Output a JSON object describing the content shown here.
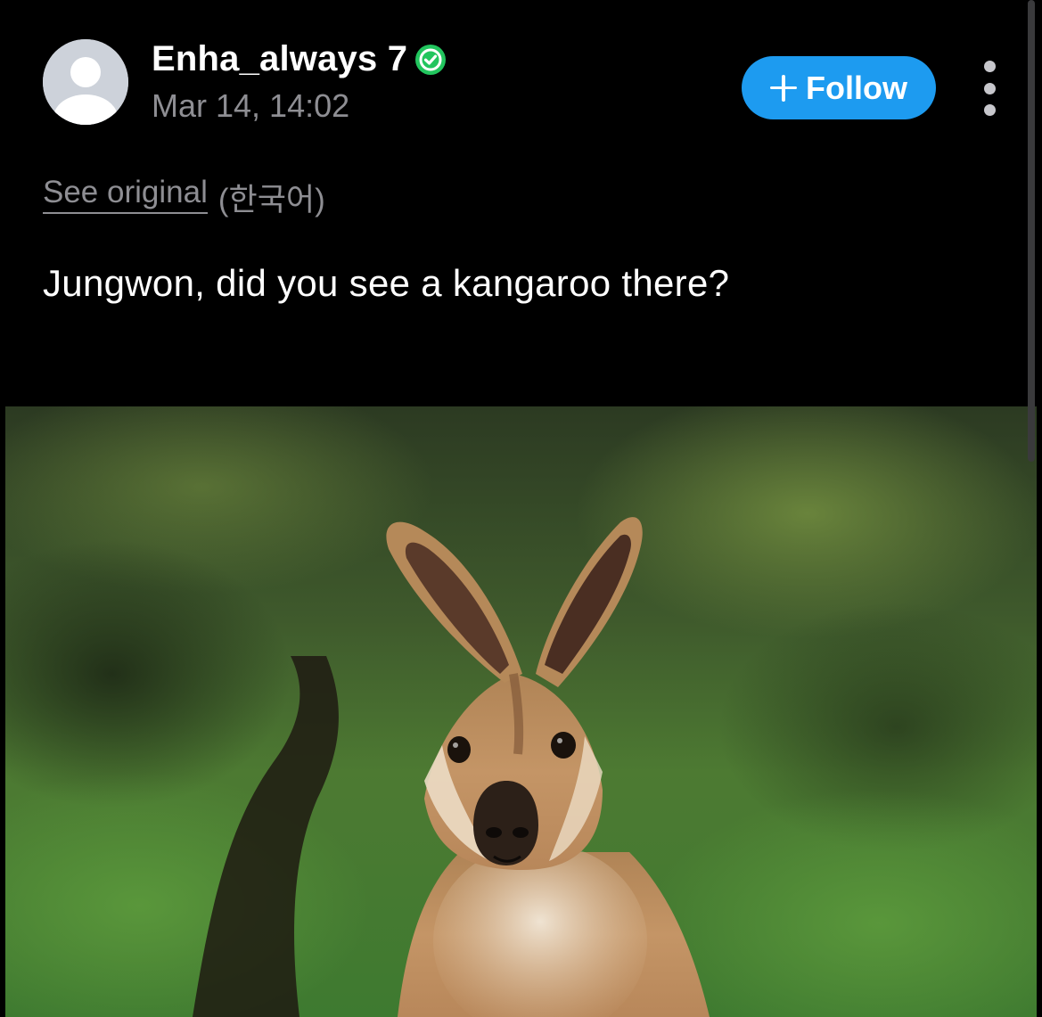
{
  "post": {
    "author": {
      "username": "Enha_always 7",
      "verified": true,
      "avatar": "default-user-avatar"
    },
    "timestamp": "Mar 14, 14:02",
    "follow_label": "Follow",
    "translation": {
      "see_original_label": "See original",
      "language": "(한국어)"
    },
    "text": "Jungwon, did you see a kangaroo there?",
    "image": {
      "subject": "kangaroo-photo"
    }
  },
  "colors": {
    "background": "#000000",
    "accent": "#1d9bf0",
    "verified": "#22c55e",
    "muted_text": "#8e8e93"
  },
  "icons": {
    "verified": "verified-badge-icon",
    "follow": "plus-icon",
    "menu": "more-vertical-icon"
  }
}
